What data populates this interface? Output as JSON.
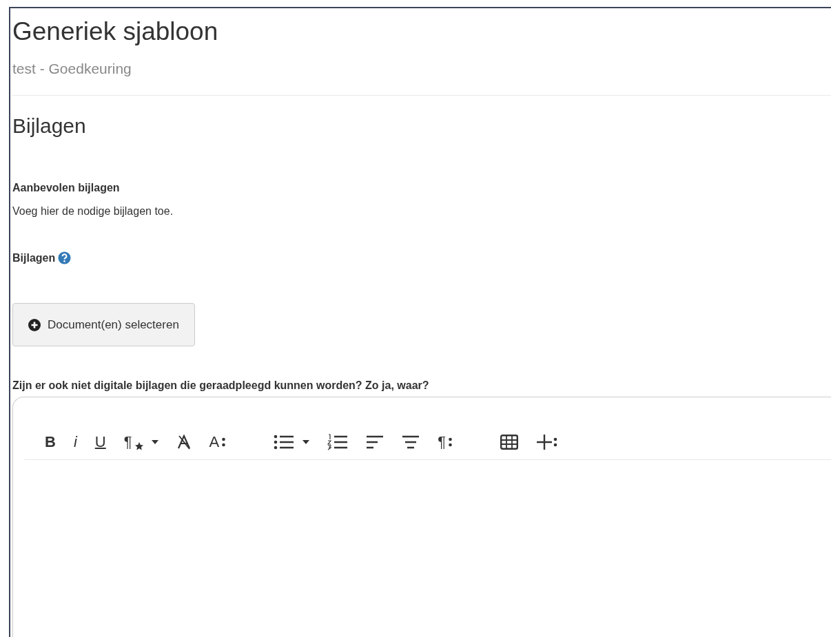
{
  "header": {
    "title": "Generiek sjabloon",
    "subtitle": "test - Goedkeuring"
  },
  "section": {
    "title": "Bijlagen",
    "recommended_label": "Aanbevolen bijlagen",
    "recommended_text": "Voeg hier de nodige bijlagen toe.",
    "attachments_label": "Bijlagen",
    "select_button": "Document(en) selecteren"
  },
  "question": {
    "label": "Zijn er ook niet digitale bijlagen die geraadpleegd kunnen worden? Zo ja, waar?"
  },
  "toolbar": [
    [
      {
        "kind": "bold",
        "label": "B"
      },
      {
        "kind": "italic",
        "label": "i"
      },
      {
        "kind": "underline",
        "label": "U"
      },
      {
        "kind": "paragraph",
        "label": "¶",
        "dropdown": true
      },
      {
        "kind": "clearformat"
      },
      {
        "kind": "fontsize",
        "label": "A"
      }
    ],
    [
      {
        "kind": "bullets",
        "dropdown": true
      },
      {
        "kind": "numbers"
      },
      {
        "kind": "alignleft"
      },
      {
        "kind": "aligncenter"
      },
      {
        "kind": "paragraphmenu",
        "label": "¶"
      }
    ],
    [
      {
        "kind": "table"
      },
      {
        "kind": "insert"
      }
    ]
  ]
}
